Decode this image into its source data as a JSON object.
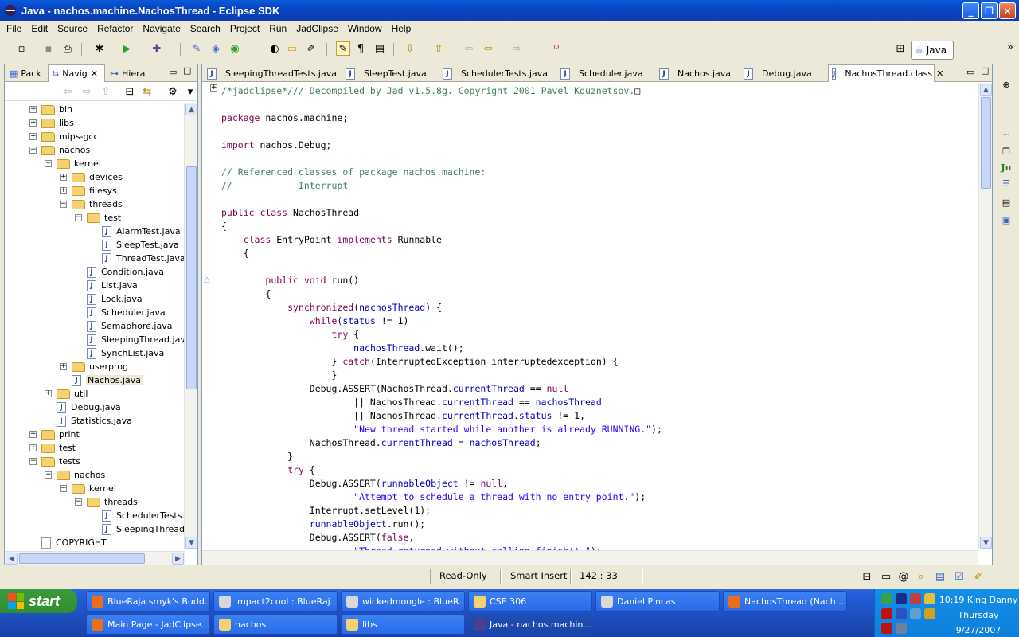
{
  "window": {
    "title": "Java - nachos.machine.NachosThread - Eclipse SDK"
  },
  "menu": [
    "File",
    "Edit",
    "Source",
    "Refactor",
    "Navigate",
    "Search",
    "Project",
    "Run",
    "JadClipse",
    "Window",
    "Help"
  ],
  "perspective": {
    "label": "Java"
  },
  "navigator": {
    "tabs": [
      {
        "label": "Pack",
        "icon": "package-explorer-icon"
      },
      {
        "label": "Navig",
        "icon": "navigator-icon",
        "active": true
      },
      {
        "label": "Hiera",
        "icon": "hierarchy-icon"
      }
    ],
    "tree": [
      {
        "label": "bin",
        "type": "folder",
        "level": 1,
        "expander": "+"
      },
      {
        "label": "libs",
        "type": "folder",
        "level": 1,
        "expander": "+"
      },
      {
        "label": "mips-gcc",
        "type": "folder",
        "level": 1,
        "expander": "+"
      },
      {
        "label": "nachos",
        "type": "folder",
        "level": 1,
        "expander": "-"
      },
      {
        "label": "kernel",
        "type": "folder",
        "level": 2,
        "expander": "-"
      },
      {
        "label": "devices",
        "type": "folder",
        "level": 3,
        "expander": "+"
      },
      {
        "label": "filesys",
        "type": "folder",
        "level": 3,
        "expander": "+"
      },
      {
        "label": "threads",
        "type": "folder",
        "level": 3,
        "expander": "-"
      },
      {
        "label": "test",
        "type": "folder",
        "level": 4,
        "expander": "-"
      },
      {
        "label": "AlarmTest.java",
        "type": "java",
        "level": 5
      },
      {
        "label": "SleepTest.java",
        "type": "java",
        "level": 5
      },
      {
        "label": "ThreadTest.java",
        "type": "java",
        "level": 5
      },
      {
        "label": "Condition.java",
        "type": "java",
        "level": 4
      },
      {
        "label": "List.java",
        "type": "java",
        "level": 4
      },
      {
        "label": "Lock.java",
        "type": "java",
        "level": 4
      },
      {
        "label": "Scheduler.java",
        "type": "java",
        "level": 4
      },
      {
        "label": "Semaphore.java",
        "type": "java",
        "level": 4
      },
      {
        "label": "SleepingThread.java",
        "type": "java",
        "level": 4
      },
      {
        "label": "SynchList.java",
        "type": "java",
        "level": 4
      },
      {
        "label": "userprog",
        "type": "folder",
        "level": 3,
        "expander": "+"
      },
      {
        "label": "Nachos.java",
        "type": "java",
        "level": 3,
        "selected": true
      },
      {
        "label": "util",
        "type": "folder",
        "level": 2,
        "expander": "+"
      },
      {
        "label": "Debug.java",
        "type": "java",
        "level": 2
      },
      {
        "label": "Statistics.java",
        "type": "java",
        "level": 2
      },
      {
        "label": "print",
        "type": "folder",
        "level": 1,
        "expander": "+"
      },
      {
        "label": "test",
        "type": "folder",
        "level": 1,
        "expander": "+"
      },
      {
        "label": "tests",
        "type": "folder",
        "level": 1,
        "expander": "-"
      },
      {
        "label": "nachos",
        "type": "folder",
        "level": 2,
        "expander": "-"
      },
      {
        "label": "kernel",
        "type": "folder",
        "level": 3,
        "expander": "-"
      },
      {
        "label": "threads",
        "type": "folder",
        "level": 4,
        "expander": "-"
      },
      {
        "label": "SchedulerTests.ja",
        "type": "java",
        "level": 5
      },
      {
        "label": "SleepingThreadTe",
        "type": "java",
        "level": 5
      },
      {
        "label": "COPYRIGHT",
        "type": "text",
        "level": 1
      }
    ]
  },
  "editor": {
    "tabs": [
      {
        "label": "SleepingThreadTests.java"
      },
      {
        "label": "SleepTest.java"
      },
      {
        "label": "SchedulerTests.java"
      },
      {
        "label": "Scheduler.java"
      },
      {
        "label": "Nachos.java"
      },
      {
        "label": "Debug.java"
      },
      {
        "label": "NachosThread.class",
        "active": true
      }
    ],
    "code": [
      [
        [
          "cm",
          "/*jadclipse*/// Decompiled by Jad v1.5.8g. Copyright 2001 Pavel Kouznetsov."
        ],
        [
          "",
          "□"
        ]
      ],
      [],
      [
        [
          "kw",
          "package"
        ],
        [
          "",
          " nachos.machine;"
        ]
      ],
      [],
      [
        [
          "kw",
          "import"
        ],
        [
          "",
          " nachos.Debug;"
        ]
      ],
      [],
      [
        [
          "cm",
          "// Referenced classes of package nachos.machine:"
        ]
      ],
      [
        [
          "cm",
          "//            Interrupt"
        ]
      ],
      [],
      [
        [
          "kw",
          "public class"
        ],
        [
          "",
          " NachosThread"
        ]
      ],
      [
        [
          "",
          "{"
        ]
      ],
      [
        [
          "",
          "    "
        ],
        [
          "kw",
          "class"
        ],
        [
          "",
          " EntryPoint "
        ],
        [
          "kw",
          "implements"
        ],
        [
          "",
          " Runnable"
        ]
      ],
      [
        [
          "",
          "    {"
        ]
      ],
      [],
      [
        [
          "",
          "        "
        ],
        [
          "kw",
          "public void"
        ],
        [
          "",
          " run()"
        ]
      ],
      [
        [
          "",
          "        {"
        ]
      ],
      [
        [
          "",
          "            "
        ],
        [
          "kw",
          "synchronized"
        ],
        [
          "",
          "("
        ],
        [
          "fd",
          "nachosThread"
        ],
        [
          "",
          ") {"
        ]
      ],
      [
        [
          "",
          "                "
        ],
        [
          "kw",
          "while"
        ],
        [
          "",
          "("
        ],
        [
          "fd",
          "status"
        ],
        [
          "",
          " != 1)"
        ]
      ],
      [
        [
          "",
          "                    "
        ],
        [
          "kw",
          "try"
        ],
        [
          "",
          " {"
        ]
      ],
      [
        [
          "",
          "                        "
        ],
        [
          "fd",
          "nachosThread"
        ],
        [
          "",
          ".wait();"
        ]
      ],
      [
        [
          "",
          "                    } "
        ],
        [
          "kw",
          "catch"
        ],
        [
          "",
          "(InterruptedException interruptedexception) {"
        ]
      ],
      [
        [
          "",
          "                    }"
        ]
      ],
      [
        [
          "",
          "                Debug."
        ],
        [
          "",
          "ASSERT(NachosThread."
        ],
        [
          "fd",
          "currentThread"
        ],
        [
          "",
          " == "
        ],
        [
          "kw",
          "null"
        ]
      ],
      [
        [
          "",
          "                        || NachosThread."
        ],
        [
          "fd",
          "currentThread"
        ],
        [
          "",
          " == "
        ],
        [
          "fd",
          "nachosThread"
        ]
      ],
      [
        [
          "",
          "                        || NachosThread."
        ],
        [
          "fd",
          "currentThread"
        ],
        [
          "",
          "."
        ],
        [
          "fd",
          "status"
        ],
        [
          "",
          " != 1,"
        ]
      ],
      [
        [
          "",
          "                        "
        ],
        [
          "st",
          "\"New thread started while another is already RUNNING.\""
        ],
        [
          "",
          ");"
        ]
      ],
      [
        [
          "",
          "                NachosThread."
        ],
        [
          "fd",
          "currentThread"
        ],
        [
          "",
          " = "
        ],
        [
          "fd",
          "nachosThread"
        ],
        [
          "",
          ";"
        ]
      ],
      [
        [
          "",
          "            }"
        ]
      ],
      [
        [
          "",
          "            "
        ],
        [
          "kw",
          "try"
        ],
        [
          "",
          " {"
        ]
      ],
      [
        [
          "",
          "                Debug.ASSERT("
        ],
        [
          "fd",
          "runnableObject"
        ],
        [
          "",
          " != "
        ],
        [
          "kw",
          "null"
        ],
        [
          "",
          ","
        ]
      ],
      [
        [
          "",
          "                        "
        ],
        [
          "st",
          "\"Attempt to schedule a thread with no entry point.\""
        ],
        [
          "",
          ");"
        ]
      ],
      [
        [
          "",
          "                Interrupt.setLevel(1);"
        ]
      ],
      [
        [
          "",
          "                "
        ],
        [
          "fd",
          "runnableObject"
        ],
        [
          "",
          ".run();"
        ]
      ],
      [
        [
          "",
          "                Debug.ASSERT("
        ],
        [
          "kw",
          "false"
        ],
        [
          "",
          ","
        ]
      ],
      [
        [
          "",
          "                        "
        ],
        [
          "st",
          "\"Thread returned without calling finish().\""
        ],
        [
          "",
          ");"
        ]
      ]
    ]
  },
  "status": {
    "mode": "Read-Only",
    "insert": "Smart Insert",
    "position": "142 : 33"
  },
  "taskbar": {
    "start": "start",
    "row1": [
      {
        "label": "BlueRaja smyk's Budd...",
        "color": "#e8701a"
      },
      {
        "label": "impact2cool : BlueRaj...",
        "color": "#d8d8d8"
      },
      {
        "label": "wickedmoogle : BlueR...",
        "color": "#d8d8d8"
      },
      {
        "label": "CSE 306",
        "color": "#f4d271"
      },
      {
        "label": "Daniel Pincas",
        "color": "#d8d8d8"
      },
      {
        "label": "NachosThread (Nach...",
        "color": "#e8701a"
      }
    ],
    "row2": [
      {
        "label": "Main Page - JadClipse...",
        "color": "#e8701a"
      },
      {
        "label": "nachos",
        "color": "#f4d271"
      },
      {
        "label": "libs",
        "color": "#f4d271"
      },
      {
        "label": "Java - nachos.machin...",
        "color": "#4b3f8f",
        "active": true
      }
    ],
    "clock": {
      "time": "10:19",
      "user": "King Danny",
      "day": "Thursday",
      "date": "9/27/2007"
    }
  }
}
